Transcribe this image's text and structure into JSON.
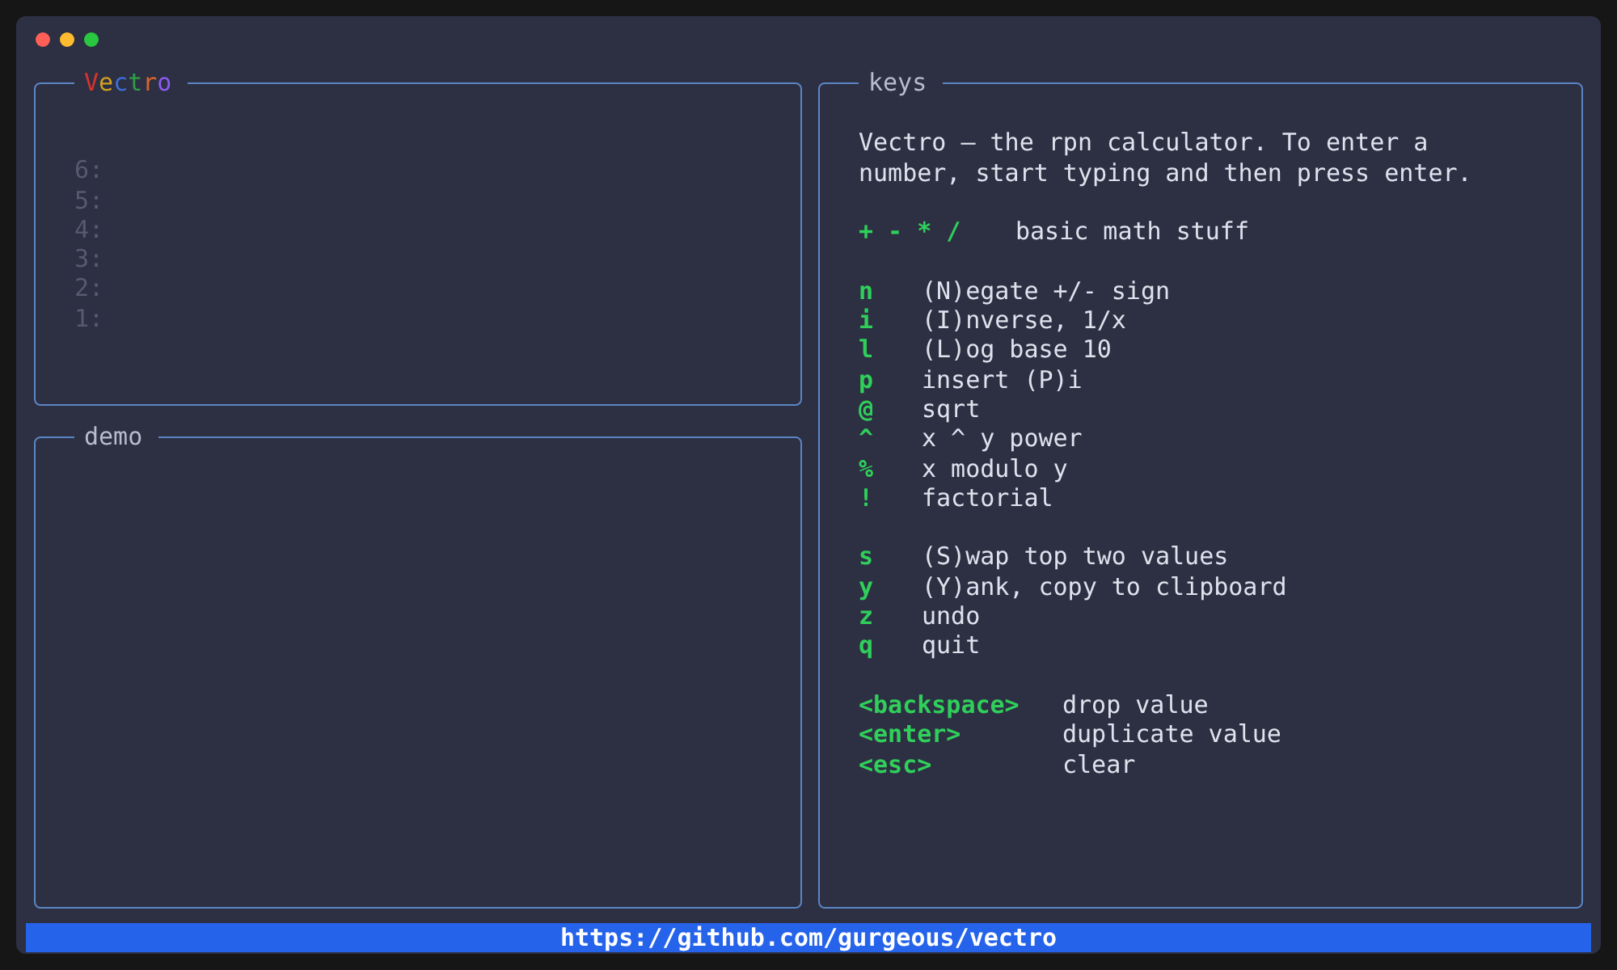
{
  "window": {
    "controls": [
      {
        "color": "#ff5f57"
      },
      {
        "color": "#febc2e"
      },
      {
        "color": "#28c840"
      }
    ]
  },
  "stack_panel": {
    "title": "Vectro",
    "letter_colors": [
      {
        "color": "#d9342b"
      },
      {
        "color": "#d4a020"
      },
      {
        "color": "#3b6fd8"
      },
      {
        "color": "#2f9e44"
      },
      {
        "color": "#d9642b"
      },
      {
        "color": "#8a5cf0"
      }
    ],
    "slots": [
      "6:",
      "5:",
      "4:",
      "3:",
      "2:",
      "1:"
    ]
  },
  "demo_panel": {
    "title": "demo"
  },
  "keys_panel": {
    "title": "keys",
    "intro": "Vectro – the rpn calculator. To enter a number, start typing and then press enter.",
    "groups": [
      {
        "kind": "ops",
        "rows": [
          {
            "key": "+ - * /",
            "action": "basic math stuff"
          }
        ]
      },
      {
        "kind": "letters",
        "rows": [
          {
            "key": "n",
            "action": "(N)egate +/- sign"
          },
          {
            "key": "i",
            "action": "(I)nverse, 1/x"
          },
          {
            "key": "l",
            "action": "(L)og base 10"
          },
          {
            "key": "p",
            "action": "insert (P)i"
          },
          {
            "key": "@",
            "action": "sqrt"
          },
          {
            "key": "^",
            "action": "x ^ y power"
          },
          {
            "key": "%",
            "action": "x modulo y"
          },
          {
            "key": "!",
            "action": "factorial"
          }
        ]
      },
      {
        "kind": "letters",
        "rows": [
          {
            "key": "s",
            "action": "(S)wap top two values"
          },
          {
            "key": "y",
            "action": "(Y)ank, copy to clipboard"
          },
          {
            "key": "z",
            "action": "undo"
          },
          {
            "key": "q",
            "action": "quit"
          }
        ]
      },
      {
        "kind": "special",
        "rows": [
          {
            "key": "<backspace>",
            "action": "drop value"
          },
          {
            "key": "<enter>",
            "action": "duplicate value"
          },
          {
            "key": "<esc>",
            "action": "clear"
          }
        ]
      }
    ]
  },
  "status_bar": {
    "text": "https://github.com/gurgeous/vectro"
  }
}
